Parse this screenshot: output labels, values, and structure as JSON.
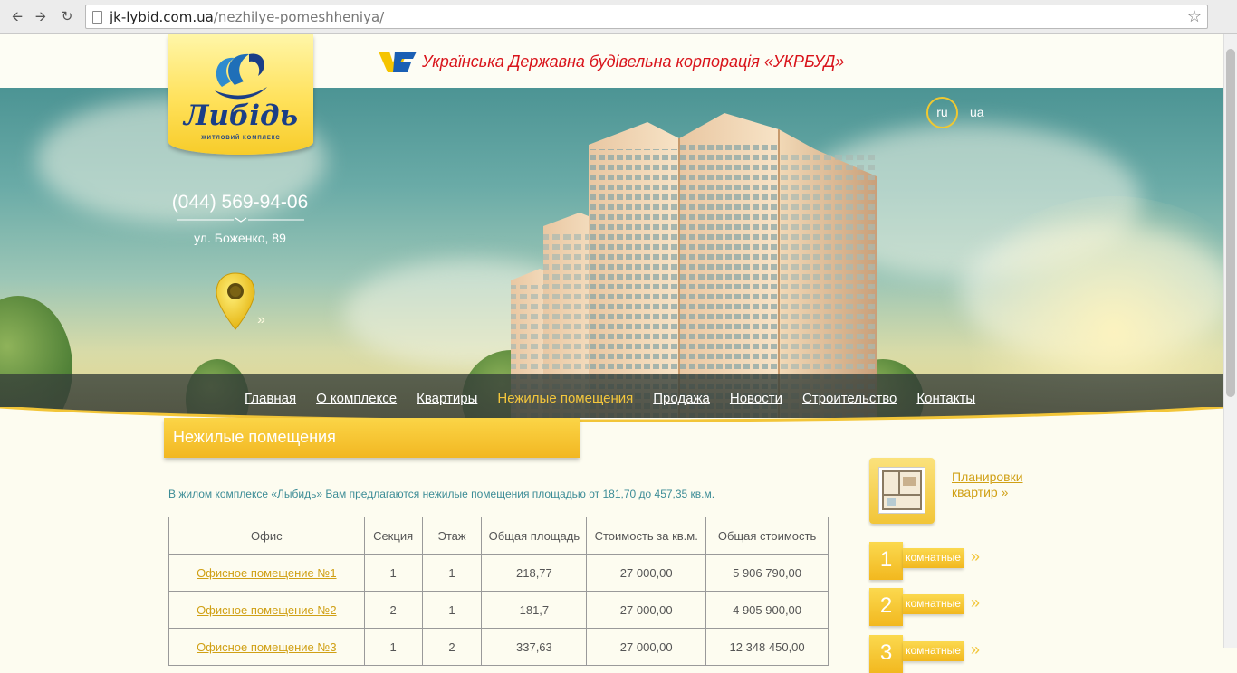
{
  "browser": {
    "url_host": "jk-lybid.com.ua",
    "url_path": "/nezhilye-pomeshheniya/"
  },
  "header": {
    "corporation_text": "Українська Державна будівельна корпорація «УКРБУД»",
    "logo_brand": "Либідь",
    "logo_subtitle": "ЖИТЛОВИЙ КОМПЛЕКС",
    "phone": "(044) 569-94-06",
    "address": "ул. Боженко, 89"
  },
  "languages": {
    "ru": "ru",
    "ua": "ua"
  },
  "menu": [
    {
      "label": "Главная",
      "active": false
    },
    {
      "label": "О комплексе",
      "active": false
    },
    {
      "label": "Квартиры",
      "active": false
    },
    {
      "label": "Нежилые помещения",
      "active": true
    },
    {
      "label": "Продажа",
      "active": false
    },
    {
      "label": "Новости",
      "active": false
    },
    {
      "label": "Строительство",
      "active": false
    },
    {
      "label": "Контакты",
      "active": false
    }
  ],
  "page": {
    "title": "Нежилые помещения",
    "intro": "В жилом комплексе «Лыбидь» Вам предлагаются нежилые помещения площадью от 181,70 до 457,35 кв.м."
  },
  "table": {
    "headers": [
      "Офис",
      "Секция",
      "Этаж",
      "Общая площадь",
      "Стоимость за кв.м.",
      "Общая стоимость"
    ],
    "rows": [
      [
        "Офисное помещение №1",
        "1",
        "1",
        "218,77",
        "27 000,00",
        "5 906 790,00"
      ],
      [
        "Офисное помещение №2",
        "2",
        "1",
        "181,7",
        "27 000,00",
        "4 905 900,00"
      ],
      [
        "Офисное помещение №3",
        "1",
        "2",
        "337,63",
        "27 000,00",
        "12 348 450,00"
      ]
    ]
  },
  "sidebar": {
    "plans_link_line1": "Планировки",
    "plans_link_line2": "квартир »",
    "rooms": [
      {
        "number": "1",
        "label": "комнатные"
      },
      {
        "number": "2",
        "label": "комнатные"
      },
      {
        "number": "3",
        "label": "комнатные"
      }
    ]
  },
  "colors": {
    "accent_yellow": "#f2c538",
    "menu_active": "#f3c63c",
    "corp_red": "#d9141b",
    "link_gold": "#d0a015",
    "intro_teal": "#3c8c96"
  }
}
